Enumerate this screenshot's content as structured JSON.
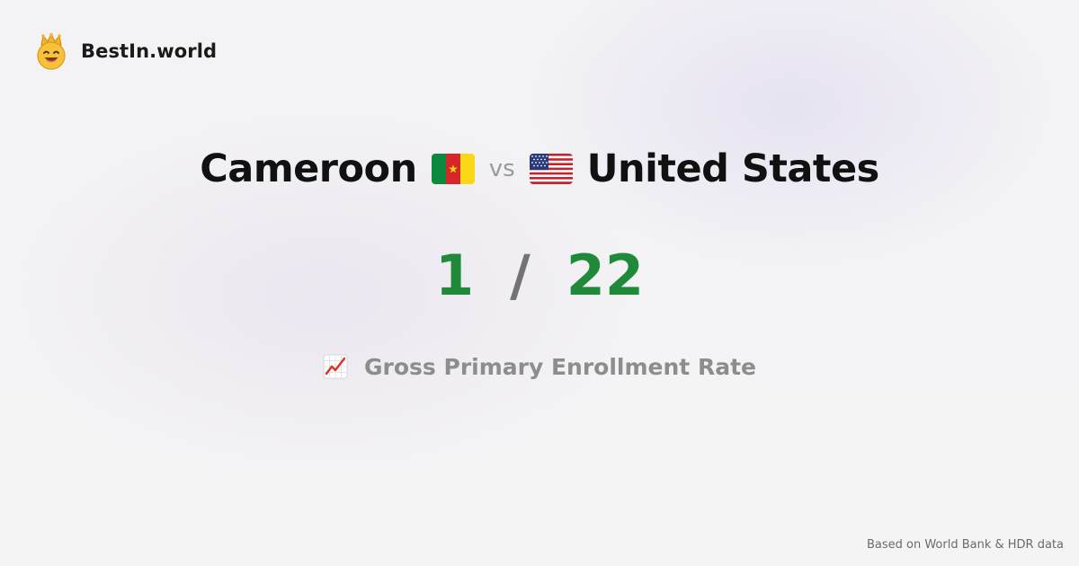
{
  "brand": {
    "name": "BestIn.world",
    "logo_icon": "crowned-smiley-icon"
  },
  "comparison": {
    "left_country": "Cameroon",
    "left_flag": "cameroon-flag-icon",
    "vs_label": "vs",
    "right_country": "United States",
    "right_flag": "us-flag-icon"
  },
  "ranks": {
    "left_rank": "1",
    "separator": "/",
    "right_rank": "22"
  },
  "metric": {
    "icon": "chart-increasing-icon",
    "label": "Gross Primary Enrollment Rate"
  },
  "footer": {
    "source": "Based on World Bank & HDR data"
  },
  "colors": {
    "rank_green": "#1f8a3a",
    "separator_gray": "#737373",
    "label_gray": "#8d8d8d",
    "background": "#f4f3f5"
  }
}
